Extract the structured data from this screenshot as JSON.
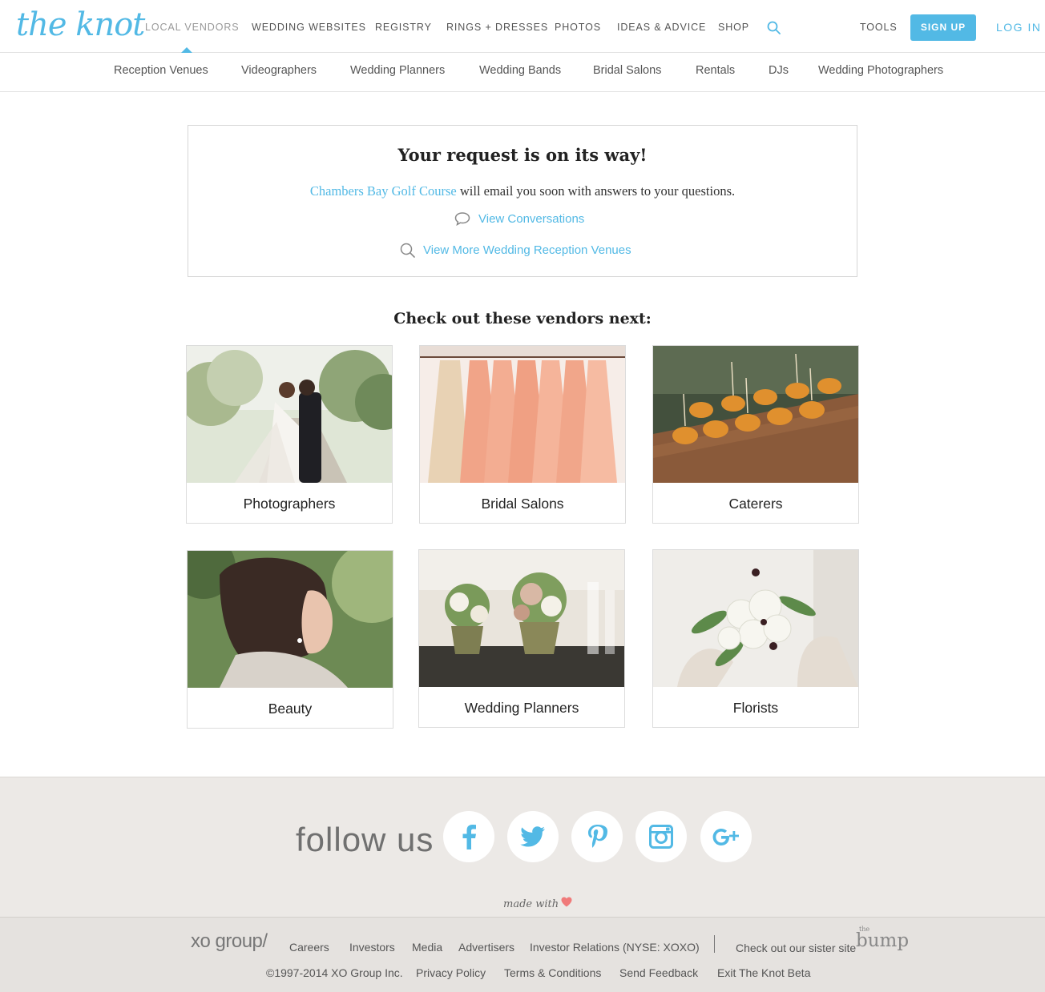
{
  "header": {
    "logo": "the knot",
    "nav": [
      {
        "label": "LOCAL VENDORS"
      },
      {
        "label": "WEDDING WEBSITES"
      },
      {
        "label": "REGISTRY"
      },
      {
        "label": "RINGS + DRESSES"
      },
      {
        "label": "PHOTOS"
      },
      {
        "label": "IDEAS & ADVICE"
      },
      {
        "label": "SHOP"
      }
    ],
    "tools": "TOOLS",
    "signup": "SIGN UP",
    "login": "LOG IN"
  },
  "categories": [
    "Reception Venues",
    "Videographers",
    "Wedding Planners",
    "Wedding Bands",
    "Bridal Salons",
    "Rentals",
    "DJs",
    "Wedding Photographers"
  ],
  "confirmation": {
    "title": "Your request is on its way!",
    "vendor": "Chambers Bay Golf Course",
    "message": " will email you soon with answers to your questions.",
    "view_conversations": "View Conversations",
    "view_more": "View More Wedding Reception Venues"
  },
  "next_section": {
    "title": "Check out these vendors next:",
    "cards": [
      {
        "label": "Photographers"
      },
      {
        "label": "Bridal Salons"
      },
      {
        "label": "Caterers"
      },
      {
        "label": "Beauty"
      },
      {
        "label": "Wedding Planners"
      },
      {
        "label": "Florists"
      }
    ]
  },
  "footer": {
    "follow_us": "follow us",
    "social": [
      "facebook",
      "twitter",
      "pinterest",
      "instagram",
      "google-plus"
    ],
    "made_with": "made with",
    "brand": "xo group/",
    "links_row1": [
      "Careers",
      "Investors",
      "Media",
      "Advertisers",
      "Investor Relations (NYSE: XOXO)"
    ],
    "sister_site": "Check out our sister site",
    "bump_logo": "bump",
    "bump_small": "the",
    "copyright": "©1997-2014 XO Group Inc.",
    "links_row2": [
      "Privacy Policy",
      "Terms & Conditions",
      "Send Feedback",
      "Exit The Knot Beta"
    ]
  },
  "colors": {
    "accent": "#52b9e5",
    "heart": "#f07a7a",
    "footer_bg": "#ece9e6"
  }
}
